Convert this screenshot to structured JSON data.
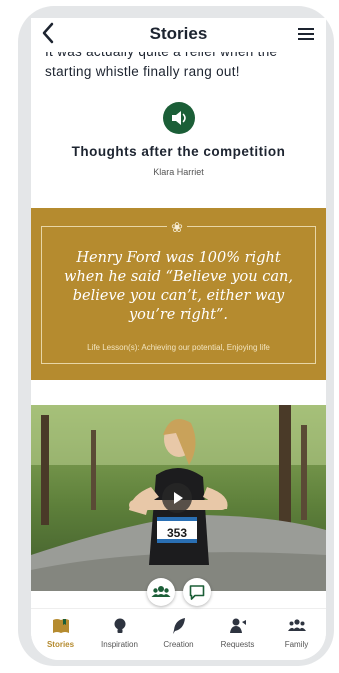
{
  "header": {
    "title": "Stories",
    "back_glyph": "‹",
    "menu_icon": "menu-icon"
  },
  "story": {
    "text_partial": "It was actually quite a relief when the",
    "text_line2": "starting whistle finally rang out!",
    "title": "Thoughts after the competition",
    "author": "Klara Harriet"
  },
  "quote": {
    "ornament": "❀",
    "text_lines": [
      "Henry Ford was 100% right",
      "when he said “Believe you can,",
      "believe you can’t, either way",
      "you’re right”."
    ],
    "tags": "Life Lesson(s): Achieving our potential, Enjoying life"
  },
  "photo": {
    "bib_number": "353"
  },
  "tabs": [
    {
      "label": "Stories",
      "icon": "book-icon",
      "active": true
    },
    {
      "label": "Inspiration",
      "icon": "lightbulb-icon",
      "active": false
    },
    {
      "label": "Creation",
      "icon": "feather-icon",
      "active": false
    },
    {
      "label": "Requests",
      "icon": "person-request-icon",
      "active": false
    },
    {
      "label": "Family",
      "icon": "family-icon",
      "active": false
    }
  ],
  "colors": {
    "brand_gold": "#b58b2f",
    "brand_green": "#1b5e37",
    "text": "#1d2430"
  }
}
